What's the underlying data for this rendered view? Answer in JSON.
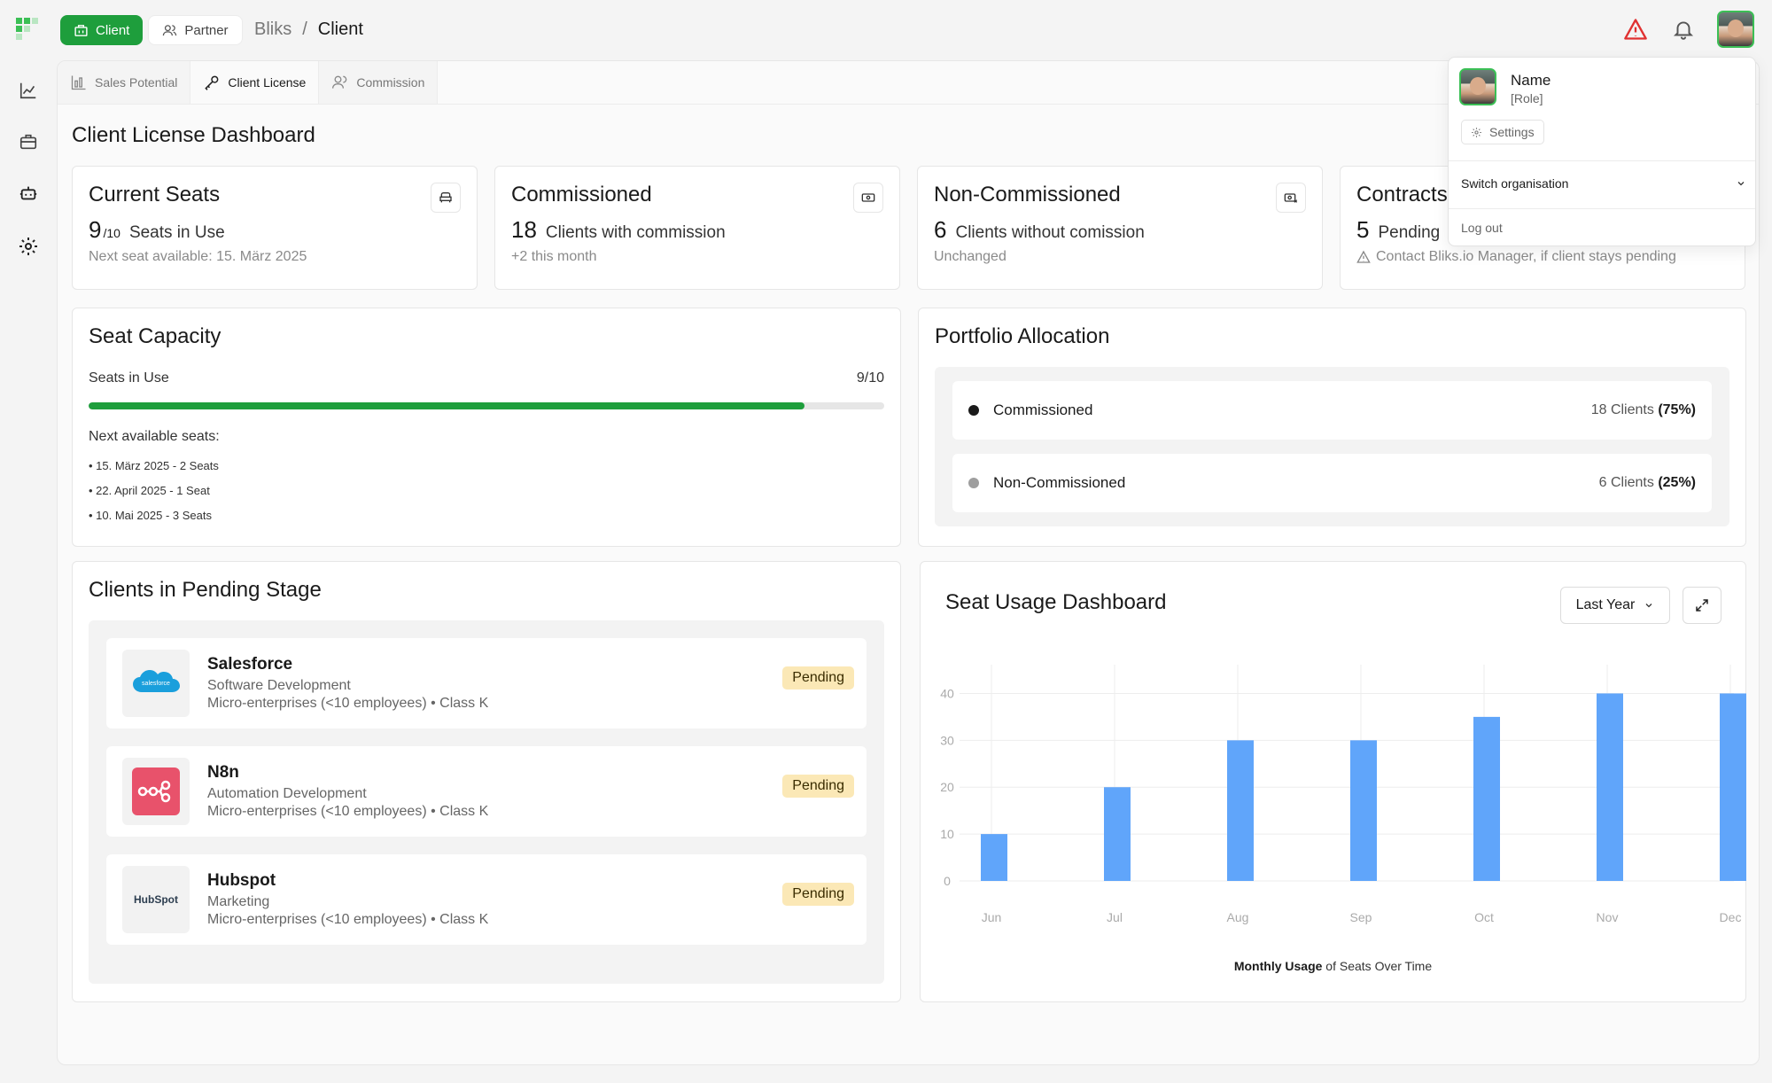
{
  "header": {
    "mode_tabs": [
      {
        "label": "Client"
      },
      {
        "label": "Partner"
      }
    ],
    "breadcrumb": {
      "root": "Bliks",
      "separator": "/",
      "current": "Client"
    },
    "icons": [
      "warning-icon",
      "bell-icon",
      "avatar"
    ]
  },
  "sidebar": {
    "icons": [
      "chart-icon",
      "briefcase-icon",
      "robot-icon",
      "settings-gear-icon"
    ]
  },
  "tabs": [
    {
      "label": "Sales Potential"
    },
    {
      "label": "Client License"
    },
    {
      "label": "Commission"
    }
  ],
  "page_title": "Client License Dashboard",
  "stats": {
    "current_seats": {
      "title": "Current Seats",
      "value": "9",
      "denominator": "/10",
      "label": "Seats in Use",
      "sub": "Next seat available: 15. März 2025"
    },
    "commissioned": {
      "title": "Commissioned",
      "value": "18",
      "label": "Clients with commission",
      "sub": "+2 this month"
    },
    "non_commissioned": {
      "title": "Non-Commissioned",
      "value": "6",
      "label": "Clients without comission",
      "sub": "Unchanged"
    },
    "contracts": {
      "title": "Contracts",
      "value": "5",
      "label": "Pending",
      "sub": "Contact Bliks.io Manager, if client stays pending"
    }
  },
  "seat_capacity": {
    "title": "Seat Capacity",
    "label": "Seats in Use",
    "value": "9/10",
    "fraction": 0.9,
    "next_title": "Next available seats:",
    "next": [
      "• 15. März 2025 - 2 Seats",
      "• 22. April 2025 - 1 Seat",
      "• 10. Mai 2025 - 3 Seats"
    ]
  },
  "portfolio": {
    "title": "Portfolio Allocation",
    "rows": [
      {
        "label": "Commissioned",
        "count": "18 Clients",
        "pct": "(75%)",
        "color": "#1a1a1a"
      },
      {
        "label": "Non-Commissioned",
        "count": "6 Clients",
        "pct": "(25%)",
        "color": "#9e9e9e"
      }
    ]
  },
  "pending": {
    "title": "Clients in Pending Stage",
    "clients": [
      {
        "name": "Salesforce",
        "industry": "Software Development",
        "class": "Micro-enterprises (<10 employees) • Class K",
        "status": "Pending",
        "logo_text": "salesforce"
      },
      {
        "name": "N8n",
        "industry": "Automation Development",
        "class": "Micro-enterprises (<10 employees) • Class K",
        "status": "Pending"
      },
      {
        "name": "Hubspot",
        "industry": "Marketing",
        "class": "Micro-enterprises (<10 employees) • Class K",
        "status": "Pending",
        "logo_text": "HubSpot"
      }
    ]
  },
  "usage": {
    "title": "Seat Usage Dashboard",
    "period": "Last Year",
    "caption_bold": "Monthly Usage",
    "caption_rest": " of Seats Over Time"
  },
  "chart_data": {
    "type": "bar",
    "categories": [
      "Jun",
      "Jul",
      "Aug",
      "Sep",
      "Oct",
      "Nov",
      "Dec"
    ],
    "values": [
      10,
      20,
      30,
      30,
      35,
      40,
      40
    ],
    "yticks": [
      0,
      10,
      20,
      30,
      40
    ],
    "ylim": [
      0,
      45
    ],
    "bar_color": "#60a5fa",
    "grid": true
  },
  "profile_menu": {
    "name": "Name",
    "role": "[Role]",
    "settings": "Settings",
    "switch": "Switch organisation",
    "logout": "Log out"
  },
  "colors": {
    "brand_green": "#1e9e3c",
    "pending_badge": "#fbe8b6",
    "warning_red": "#e03131"
  }
}
